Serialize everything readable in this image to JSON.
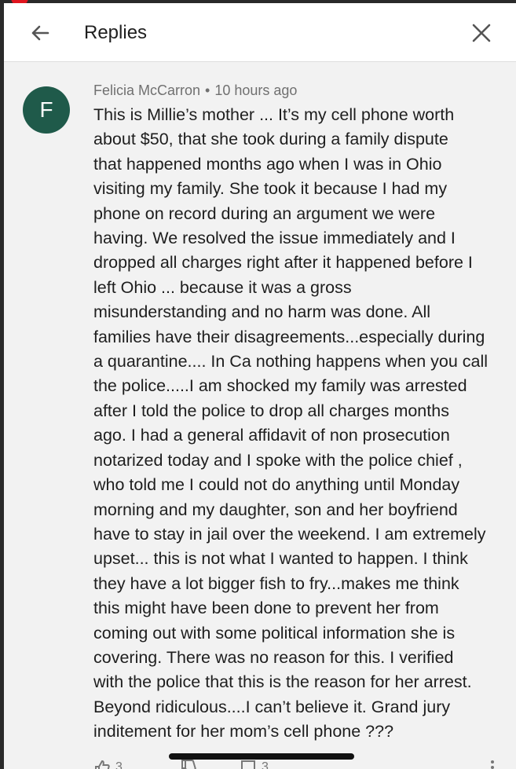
{
  "header": {
    "title": "Replies"
  },
  "comment": {
    "avatar_letter": "F",
    "author": "Felicia McCarron",
    "separator": "•",
    "time": "10 hours ago",
    "lines": [
      "This is Millie’s mother ... It’s my cell phone worth",
      "about $50,  that she took during a family dispute",
      "that happened months ago when I was in Ohio",
      "visiting my family. She took it because I had my",
      "phone on record during an argument we were",
      "having. We resolved the issue immediately and I",
      "dropped all charges right after it happened before I",
      "left Ohio ... because it was a gross",
      "misunderstanding and no harm was done. All",
      "families have their disagreements...especially during",
      "a quarantine.... In Ca nothing happens when you call",
      "the police.....I am shocked my family was arrested",
      "after I told the police to drop all charges months",
      "ago. I had a general affidavit of non prosecution",
      "notarized today and I spoke with the police chief ,",
      "who told me I could not do anything until Monday",
      "morning and my daughter, son and her boyfriend",
      "have to stay in jail over the weekend. I am extremely",
      "upset... this is not what I wanted to happen. I think",
      "they have a lot bigger fish to fry...makes me think",
      "this might have been done to prevent her from",
      "coming out with some political information she is",
      "covering. There was no reason for this. I verified",
      "with the police that this is the reason for her arrest.",
      "Beyond ridiculous....I can’t believe it. Grand jury",
      "inditement for her mom’s cell phone ???"
    ]
  },
  "actions": {
    "like_count": "3",
    "reply_count": "3"
  },
  "colors": {
    "avatar_bg": "#1f5a4a",
    "notification_dot": "#e0141e"
  }
}
